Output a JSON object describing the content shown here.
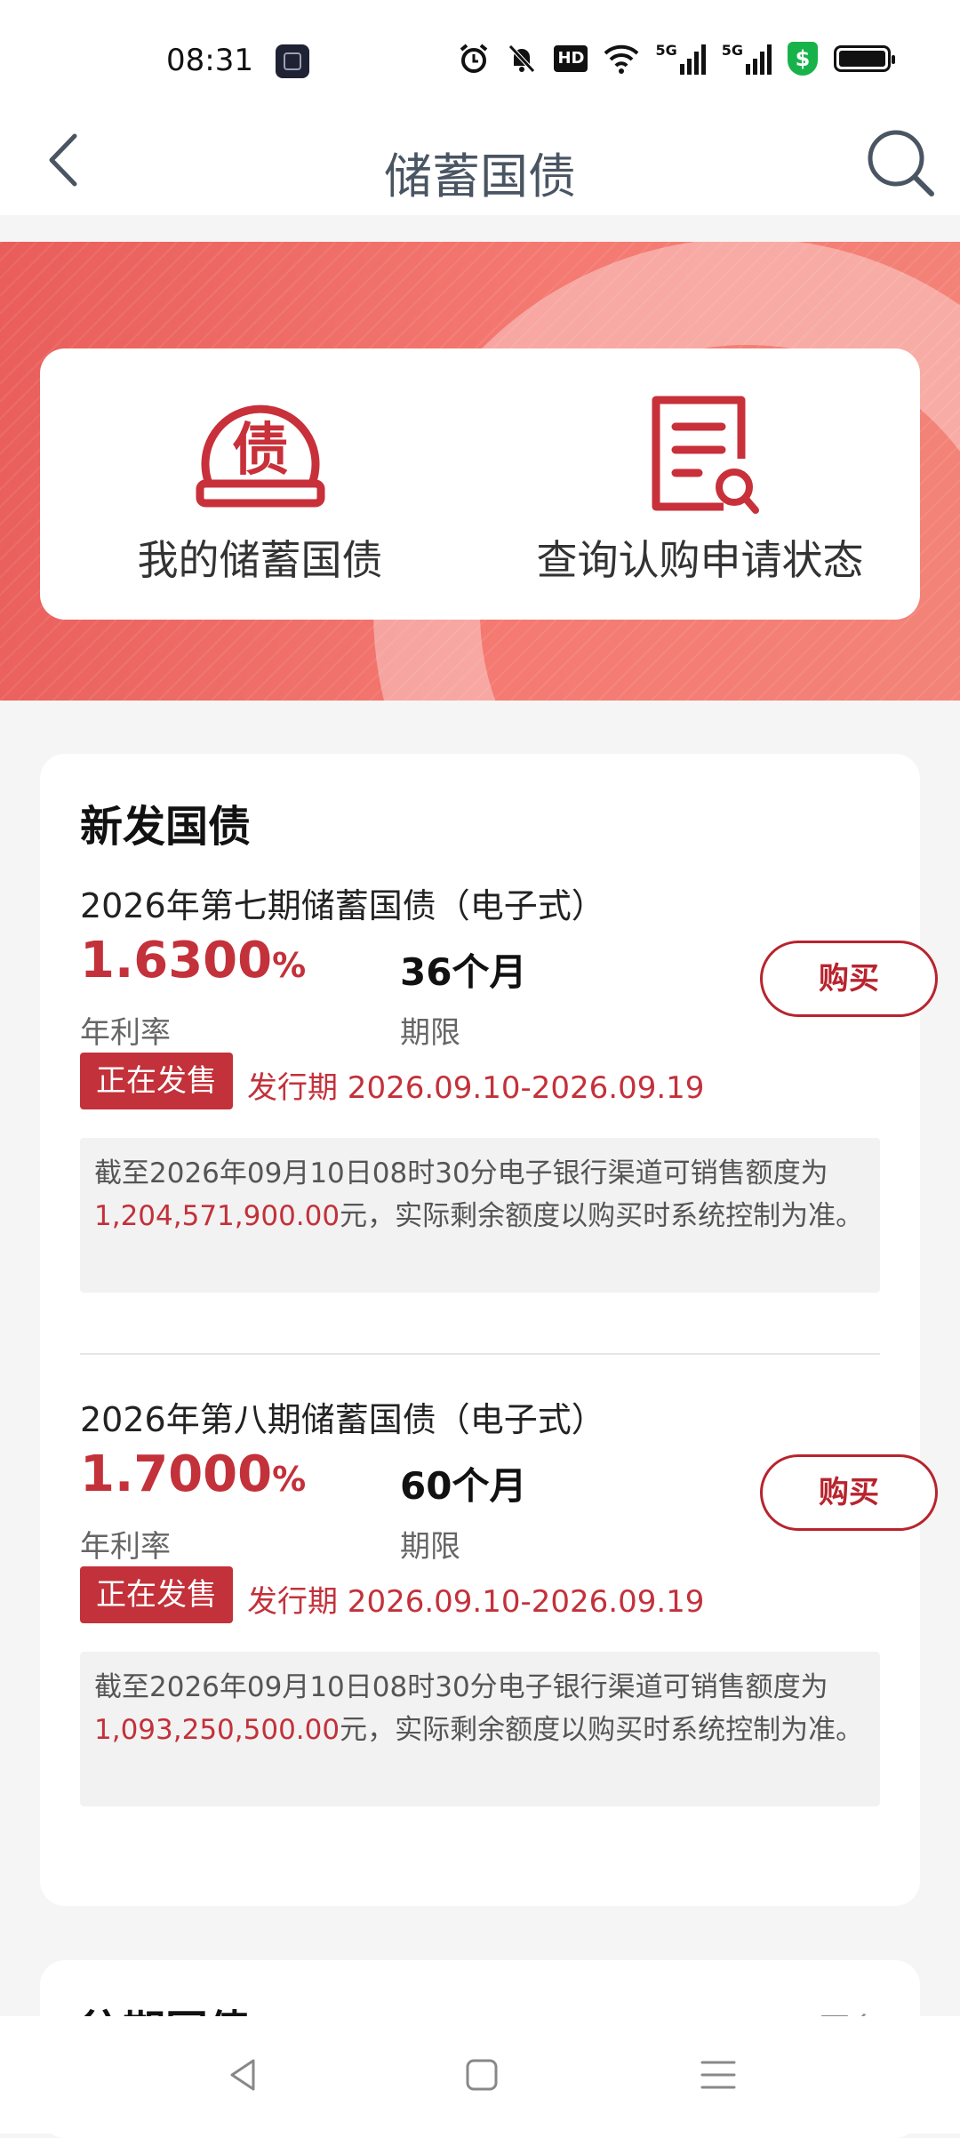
{
  "status_bar": {
    "time": "08:31",
    "icons": [
      "clock-app-icon",
      "alarm-icon",
      "mute-icon",
      "hd-icon",
      "wifi-icon",
      "5g-signal-icon",
      "5g-signal-icon",
      "security-shield-icon",
      "battery-icon"
    ],
    "hd_text": "HD",
    "signal_text": "5G",
    "shield_text": "$"
  },
  "nav": {
    "title": "储蓄国债"
  },
  "quick_actions": [
    {
      "label": "我的储蓄国债",
      "icon_char": "债",
      "icon": "bond-coin-icon"
    },
    {
      "label": "查询认购申请状态",
      "icon": "document-search-icon"
    }
  ],
  "new_bonds": {
    "title": "新发国债",
    "items": [
      {
        "name": "2026年第七期储蓄国债（电子式）",
        "rate": "1.6300",
        "rate_unit": "%",
        "rate_label": "年利率",
        "term": "36个月",
        "term_label": "期限",
        "buy_label": "购买",
        "status": "正在发售",
        "issue_period": "发行期 2026.09.10-2026.09.19",
        "quota_prefix": "截至2026年09月10日08时30分电子银行渠道可销售额度为",
        "quota_amount": "1,204,571,900.00",
        "quota_suffix": "元，实际剩余额度以购买时系统控制为准。"
      },
      {
        "name": "2026年第八期储蓄国债（电子式）",
        "rate": "1.7000",
        "rate_unit": "%",
        "rate_label": "年利率",
        "term": "60个月",
        "term_label": "期限",
        "buy_label": "购买",
        "status": "正在发售",
        "issue_period": "发行期 2026.09.10-2026.09.19",
        "quota_prefix": "截至2026年09月10日08时30分电子银行渠道可销售额度为",
        "quota_amount": "1,093,250,500.00",
        "quota_suffix": "元，实际剩余额度以购买时系统控制为准。"
      }
    ]
  },
  "past_bonds": {
    "title": "往期国债",
    "more": "更多"
  },
  "colors": {
    "accent": "#c3313a",
    "banner_start": "#e95d5a",
    "banner_end": "#f38378"
  }
}
